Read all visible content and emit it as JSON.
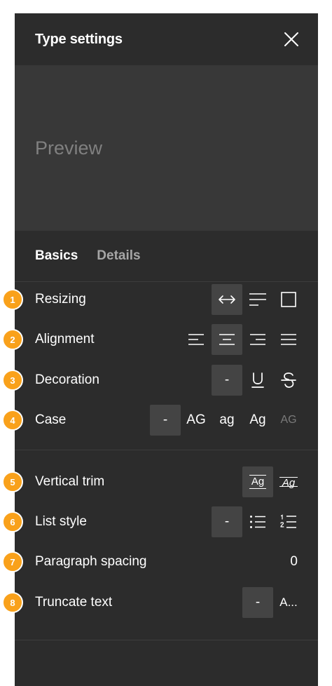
{
  "header": {
    "title": "Type settings"
  },
  "preview": {
    "text": "Preview"
  },
  "tabs": [
    {
      "label": "Basics",
      "active": true
    },
    {
      "label": "Details",
      "active": false
    }
  ],
  "rows": {
    "resizing": {
      "label": "Resizing",
      "badge": "1"
    },
    "alignment": {
      "label": "Alignment",
      "badge": "2"
    },
    "decoration": {
      "label": "Decoration",
      "badge": "3",
      "none": "-"
    },
    "case": {
      "label": "Case",
      "badge": "4",
      "none": "-",
      "upper": "AG",
      "lower": "ag",
      "title": "Ag",
      "small_caps": "AG"
    },
    "vertical_trim": {
      "label": "Vertical trim",
      "badge": "5",
      "opt1": "Ag",
      "opt2": "Ag"
    },
    "list_style": {
      "label": "List style",
      "badge": "6",
      "none": "-"
    },
    "paragraph_spacing": {
      "label": "Paragraph spacing",
      "badge": "7",
      "value": "0"
    },
    "truncate_text": {
      "label": "Truncate text",
      "badge": "8",
      "none": "-",
      "ellipsis": "A..."
    }
  },
  "colors": {
    "panel_bg": "#2c2c2c",
    "preview_bg": "#383838",
    "selected_bg": "#444444",
    "badge": "#f9a11b",
    "muted_text": "#808080"
  }
}
